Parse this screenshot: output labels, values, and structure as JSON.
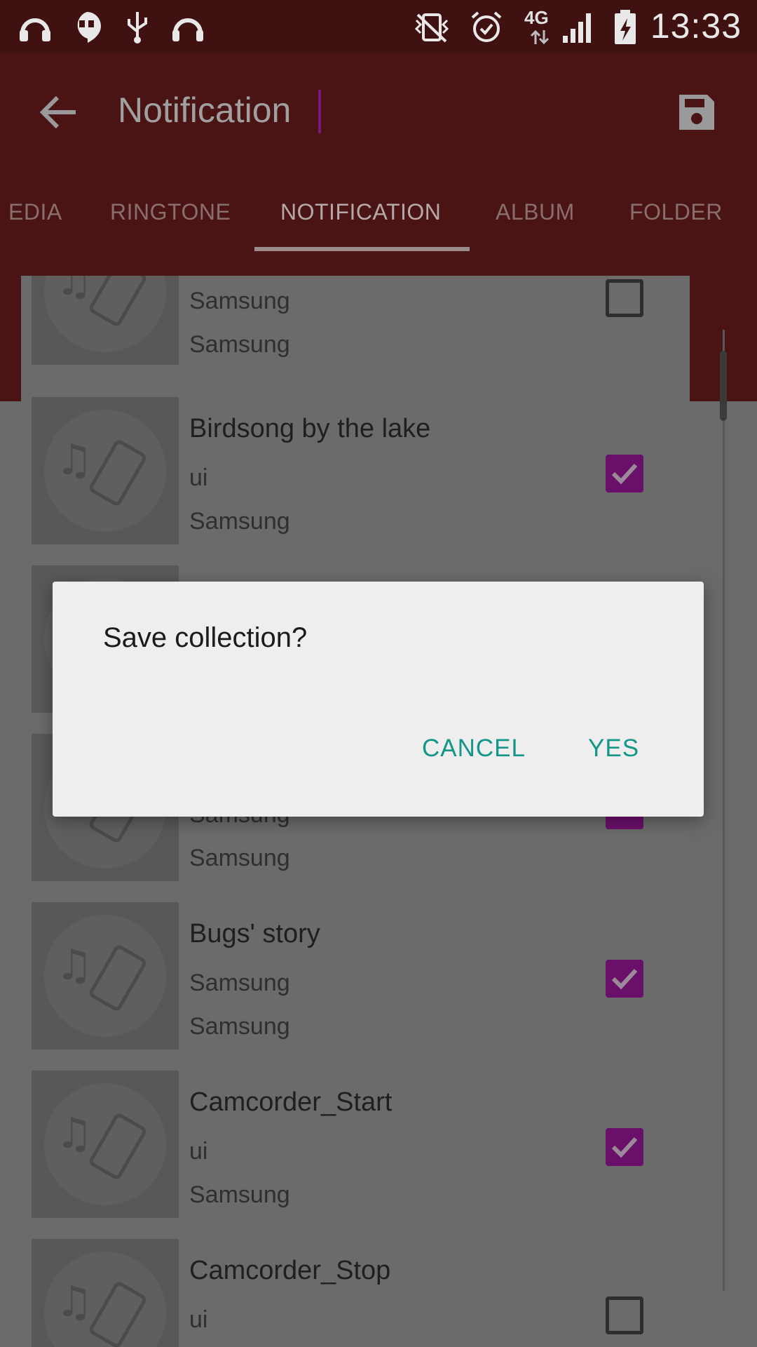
{
  "status_bar": {
    "time": "13:33",
    "network": "4G",
    "left_icons": [
      "headphones-icon",
      "hangouts-icon",
      "usb-icon",
      "headset-icon"
    ],
    "right_icons": [
      "vibrate-icon",
      "alarm-icon",
      "signal-icon",
      "battery-charging-icon"
    ]
  },
  "app_bar": {
    "title_value": "Notification",
    "back_icon": "back-arrow-icon",
    "save_icon": "save-icon",
    "background": "#4a1414"
  },
  "tabs": [
    {
      "label": "EDIA",
      "active": false
    },
    {
      "label": "RINGTONE",
      "active": false
    },
    {
      "label": "NOTIFICATION",
      "active": true
    },
    {
      "label": "ALBUM",
      "active": false
    },
    {
      "label": "FOLDER",
      "active": false
    }
  ],
  "list": {
    "items": [
      {
        "title": "",
        "line2": "Samsung",
        "line3": "Samsung",
        "checked": false
      },
      {
        "title": "Birdsong by the lake",
        "line2": "ui",
        "line3": "Samsung",
        "checked": true
      },
      {
        "title": "",
        "line2": "",
        "line3": "",
        "checked": true
      },
      {
        "title": "",
        "line2": "Samsung",
        "line3": "Samsung",
        "checked": true
      },
      {
        "title": "Bugs' story",
        "line2": "Samsung",
        "line3": "Samsung",
        "checked": true
      },
      {
        "title": "Camcorder_Start",
        "line2": "ui",
        "line3": "Samsung",
        "checked": true
      },
      {
        "title": "Camcorder_Stop",
        "line2": "ui",
        "line3": "",
        "checked": false
      }
    ]
  },
  "dialog": {
    "title": "Save collection?",
    "cancel_label": "CANCEL",
    "yes_label": "YES",
    "accent": "#149688"
  },
  "colors": {
    "checkbox_checked": "#6a0f6a",
    "status_bar": "#3f1211"
  }
}
